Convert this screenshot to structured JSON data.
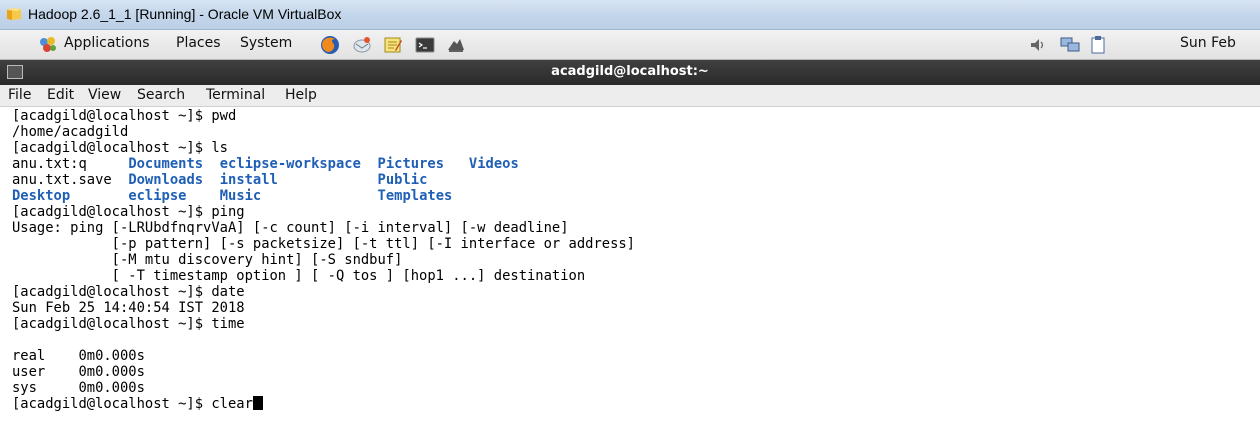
{
  "window": {
    "title": "Hadoop 2.6_1_1 [Running] - Oracle VM VirtualBox"
  },
  "panel": {
    "menus": [
      "Applications",
      "Places",
      "System"
    ],
    "clock": "Sun Feb"
  },
  "terminal_window": {
    "title": "acadgild@localhost:~",
    "menu": [
      "File",
      "Edit",
      "View",
      "Search",
      "Terminal",
      "Help"
    ]
  },
  "terminal": {
    "lines": [
      "[acadgild@localhost ~]$ pwd",
      "/home/acadgild",
      "[acadgild@localhost ~]$ ls",
      "",
      "",
      "",
      "[acadgild@localhost ~]$ ping",
      "Usage: ping [-LRUbdfnqrvVaA] [-c count] [-i interval] [-w deadline]",
      "            [-p pattern] [-s packetsize] [-t ttl] [-I interface or address]",
      "            [-M mtu discovery hint] [-S sndbuf]",
      "            [ -T timestamp option ] [ -Q tos ] [hop1 ...] destination",
      "[acadgild@localhost ~]$ date",
      "Sun Feb 25 14:40:54 IST 2018",
      "[acadgild@localhost ~]$ time",
      "",
      "real    0m0.000s",
      "user    0m0.000s",
      "sys     0m0.000s"
    ],
    "ls_files": [
      "anu.txt:q",
      "anu.txt.save"
    ],
    "ls_dirs": [
      "Desktop",
      "Documents",
      "Downloads",
      "eclipse",
      "eclipse-workspace",
      "install",
      "Music",
      "Pictures",
      "Public",
      "Templates",
      "Videos"
    ],
    "last_prompt": "[acadgild@localhost ~]$ ",
    "last_command": "clear"
  }
}
